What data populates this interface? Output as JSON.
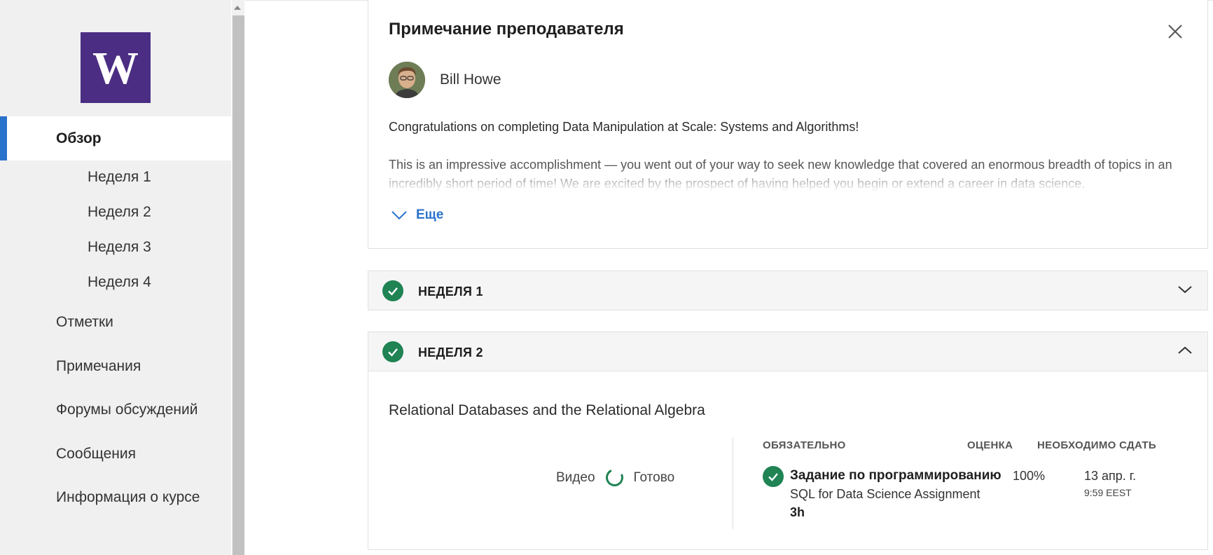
{
  "sidebar": {
    "logo_letter": "W",
    "items": [
      {
        "label": "Обзор",
        "active": true
      },
      {
        "label": "Неделя 1"
      },
      {
        "label": "Неделя 2"
      },
      {
        "label": "Неделя 3"
      },
      {
        "label": "Неделя 4"
      },
      {
        "label": "Отметки"
      },
      {
        "label": "Примечания"
      },
      {
        "label": "Форумы обсуждений"
      },
      {
        "label": "Сообщения"
      },
      {
        "label": "Информация о курсе"
      }
    ]
  },
  "note": {
    "title": "Примечание преподавателя",
    "instructor": "Bill Howe",
    "paragraph1": "Congratulations on completing Data Manipulation at Scale: Systems and Algorithms!",
    "paragraph2": "This is an impressive accomplishment — you went out of your way to seek new knowledge that covered an enormous breadth of topics in an incredibly short period of time! We are excited by the prospect of having helped you begin or extend a career in data science.",
    "more_label": "Еще"
  },
  "weeks": [
    {
      "label": "НЕДЕЛЯ 1",
      "completed": true,
      "expanded": false
    },
    {
      "label": "НЕДЕЛЯ 2",
      "completed": true,
      "expanded": true
    }
  ],
  "week2": {
    "section_title": "Relational Databases and the Relational Algebra",
    "video_label": "Видео",
    "video_status": "Готово",
    "columns": {
      "required": "ОБЯЗАТЕЛЬНО",
      "grade": "ОЦЕНКА",
      "due": "НЕОБХОДИМО СДАТЬ"
    },
    "task": {
      "type": "Задание по программированию",
      "name": "SQL for Data Science Assignment",
      "duration": "3h",
      "grade": "100%",
      "due_date": "13 апр. г.",
      "due_time": "9:59 EEST"
    }
  },
  "colors": {
    "accent": "#2a73cc",
    "success": "#1f8354",
    "brand": "#4b2e83"
  }
}
